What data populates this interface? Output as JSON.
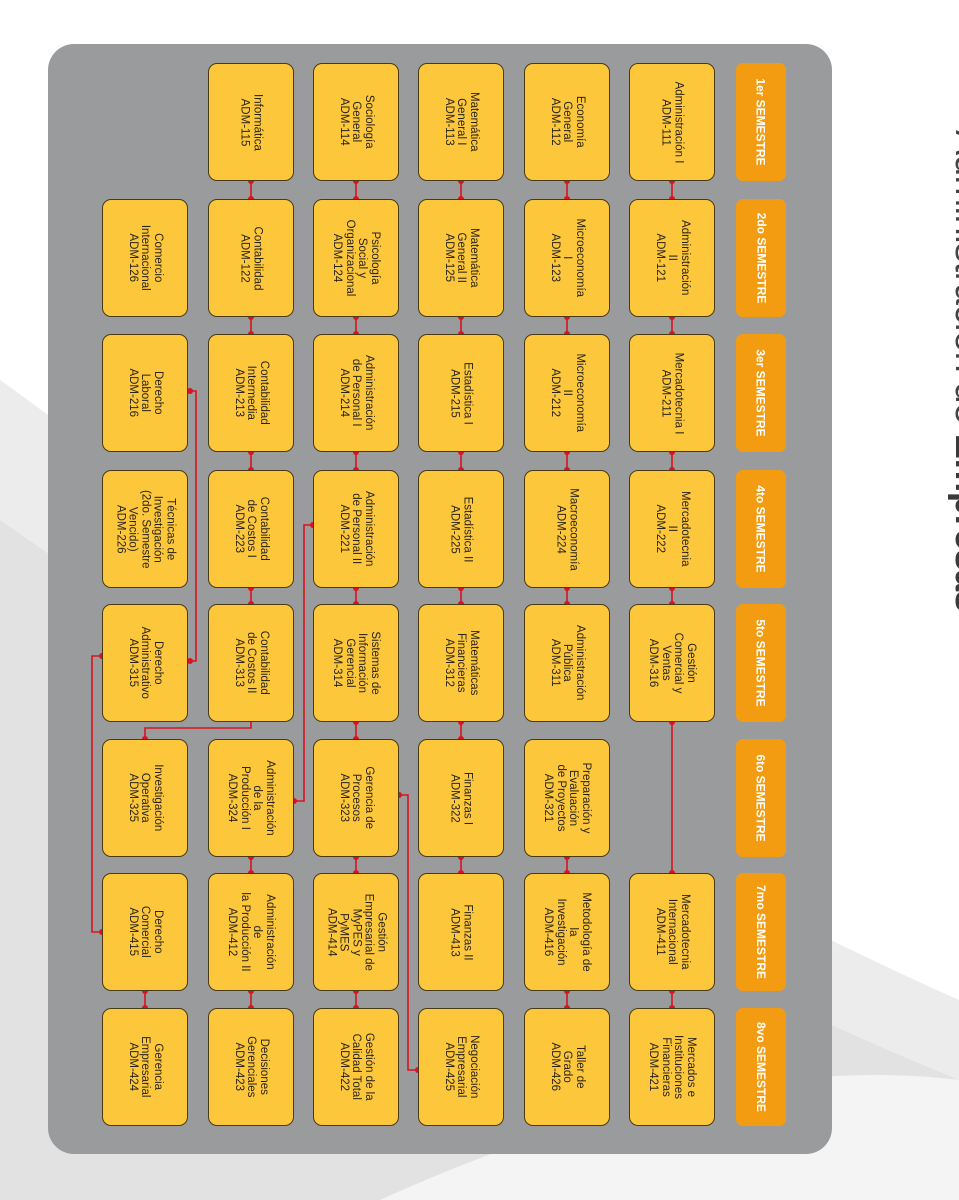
{
  "title": {
    "part1": "Administración de ",
    "part2": "Empresas"
  },
  "colors": {
    "panel": "#9a9b9d",
    "header": "#f39c12",
    "course": "#fcc73a",
    "connector": "#d7141f"
  },
  "semesters": [
    {
      "label": "1er SEMESTRE"
    },
    {
      "label": "2do SEMESTRE"
    },
    {
      "label": "3er SEMESTRE"
    },
    {
      "label": "4to SEMESTRE"
    },
    {
      "label": "5to SEMESTRE"
    },
    {
      "label": "6to SEMESTRE"
    },
    {
      "label": "7mo SEMESTRE"
    },
    {
      "label": "8vo SEMESTRE"
    }
  ],
  "courses": [
    {
      "sem": 0,
      "track": 0,
      "name": "Administración I",
      "code": "ADM-111"
    },
    {
      "sem": 0,
      "track": 1,
      "name": "Economía\nGeneral",
      "code": "ADM-112"
    },
    {
      "sem": 0,
      "track": 2,
      "name": "Matemática\nGeneral I",
      "code": "ADM-113"
    },
    {
      "sem": 0,
      "track": 3,
      "name": "Sociología\nGeneral",
      "code": "ADM-114"
    },
    {
      "sem": 0,
      "track": 4,
      "name": "Informática",
      "code": "ADM-115"
    },
    {
      "sem": 1,
      "track": 0,
      "name": "Administración II",
      "code": "ADM-121"
    },
    {
      "sem": 1,
      "track": 1,
      "name": "Microeconomía I",
      "code": "ADM-123"
    },
    {
      "sem": 1,
      "track": 2,
      "name": "Matemática\nGeneral II",
      "code": "ADM-125"
    },
    {
      "sem": 1,
      "track": 3,
      "name": "Psicología Social y\nOrganizacional",
      "code": "ADM-124"
    },
    {
      "sem": 1,
      "track": 4,
      "name": "Contabilidad",
      "code": "ADM-122"
    },
    {
      "sem": 1,
      "track": 5,
      "name": "Comercio\nInternacional",
      "code": "ADM-126"
    },
    {
      "sem": 2,
      "track": 0,
      "name": "Mercadotecnia I",
      "code": "ADM-211"
    },
    {
      "sem": 2,
      "track": 1,
      "name": "Microeconomía II",
      "code": "ADM-212"
    },
    {
      "sem": 2,
      "track": 2,
      "name": "Estadística I",
      "code": "ADM-215"
    },
    {
      "sem": 2,
      "track": 3,
      "name": "Administración\nde Personal I",
      "code": "ADM-214"
    },
    {
      "sem": 2,
      "track": 4,
      "name": "Contabilidad\nIntermedia",
      "code": "ADM-213"
    },
    {
      "sem": 2,
      "track": 5,
      "name": "Derecho\nLaboral",
      "code": "ADM-216"
    },
    {
      "sem": 3,
      "track": 0,
      "name": "Mercadotecnia II",
      "code": "ADM-222"
    },
    {
      "sem": 3,
      "track": 1,
      "name": "Macroeconomía",
      "code": "ADM-224"
    },
    {
      "sem": 3,
      "track": 2,
      "name": "Estadística II",
      "code": "ADM-225"
    },
    {
      "sem": 3,
      "track": 3,
      "name": "Administración\nde Personal II",
      "code": "ADM-221"
    },
    {
      "sem": 3,
      "track": 4,
      "name": "Contabilidad\nde Costos I",
      "code": "ADM-223"
    },
    {
      "sem": 3,
      "track": 5,
      "name": "Técnicas de Investigación\n(2do. Semestre Vencido)",
      "code": "ADM-226"
    },
    {
      "sem": 4,
      "track": 0,
      "name": "Gestión Comercial y\nVentas",
      "code": "ADM-316"
    },
    {
      "sem": 4,
      "track": 1,
      "name": "Administración\nPública",
      "code": "ADM-311"
    },
    {
      "sem": 4,
      "track": 2,
      "name": "Matemáticas\nFinancieras",
      "code": "ADM-312"
    },
    {
      "sem": 4,
      "track": 3,
      "name": "Sistemas de\nInformación Gerencial",
      "code": "ADM-314"
    },
    {
      "sem": 4,
      "track": 4,
      "name": "Contabilidad\nde Costos II",
      "code": "ADM-313"
    },
    {
      "sem": 4,
      "track": 5,
      "name": "Derecho\nAdministrativo",
      "code": "ADM-315"
    },
    {
      "sem": 5,
      "track": 1,
      "name": "Preparación y Evaluación\nde Proyectos",
      "code": "ADM-321"
    },
    {
      "sem": 5,
      "track": 2,
      "name": "Finanzas I",
      "code": "ADM-322"
    },
    {
      "sem": 5,
      "track": 3,
      "name": "Gerencia de Procesos",
      "code": "ADM-323"
    },
    {
      "sem": 5,
      "track": 4,
      "name": "Administración de la\nProducción I",
      "code": "ADM-324"
    },
    {
      "sem": 5,
      "track": 5,
      "name": "Investigación Operativa",
      "code": "ADM-325"
    },
    {
      "sem": 6,
      "track": 0,
      "name": "Mercadotecnia\nInternacional",
      "code": "ADM-411"
    },
    {
      "sem": 6,
      "track": 1,
      "name": "Metodología de la\nInvestigación",
      "code": "ADM-416"
    },
    {
      "sem": 6,
      "track": 2,
      "name": "Finanzas II",
      "code": "ADM-413"
    },
    {
      "sem": 6,
      "track": 3,
      "name": "Gestión Empresarial de\nMyPES y PyMES",
      "code": "ADM-414"
    },
    {
      "sem": 6,
      "track": 4,
      "name": "Administración de\nla Producción II",
      "code": "ADM-412"
    },
    {
      "sem": 6,
      "track": 5,
      "name": "Derecho\nComercial",
      "code": "ADM-415"
    },
    {
      "sem": 7,
      "track": 0,
      "name": "Mercados e\nInstituciones\nFinancieras",
      "code": "ADM-421"
    },
    {
      "sem": 7,
      "track": 1,
      "name": "Taller de\nGrado",
      "code": "ADM-426"
    },
    {
      "sem": 7,
      "track": 2,
      "name": "Negociación\nEmpresarial",
      "code": "ADM-425"
    },
    {
      "sem": 7,
      "track": 3,
      "name": "Gestión de la\nCalidad Total",
      "code": "ADM-422"
    },
    {
      "sem": 7,
      "track": 4,
      "name": "Decisiones\nGerenciales",
      "code": "ADM-423"
    },
    {
      "sem": 7,
      "track": 5,
      "name": "Gerencia\nEmpresarial",
      "code": "ADM-424"
    }
  ],
  "prerequisites": [
    [
      "ADM-111",
      "ADM-121"
    ],
    [
      "ADM-112",
      "ADM-123"
    ],
    [
      "ADM-113",
      "ADM-125"
    ],
    [
      "ADM-114",
      "ADM-124"
    ],
    [
      "ADM-115",
      "ADM-122"
    ],
    [
      "ADM-121",
      "ADM-211"
    ],
    [
      "ADM-123",
      "ADM-212"
    ],
    [
      "ADM-125",
      "ADM-215"
    ],
    [
      "ADM-124",
      "ADM-214"
    ],
    [
      "ADM-122",
      "ADM-213"
    ],
    [
      "ADM-211",
      "ADM-222"
    ],
    [
      "ADM-212",
      "ADM-224"
    ],
    [
      "ADM-215",
      "ADM-225"
    ],
    [
      "ADM-214",
      "ADM-221"
    ],
    [
      "ADM-213",
      "ADM-223"
    ],
    [
      "ADM-222",
      "ADM-316"
    ],
    [
      "ADM-224",
      "ADM-311"
    ],
    [
      "ADM-225",
      "ADM-312"
    ],
    [
      "ADM-221",
      "ADM-314"
    ],
    [
      "ADM-223",
      "ADM-313"
    ],
    [
      "ADM-312",
      "ADM-322"
    ],
    [
      "ADM-314",
      "ADM-323"
    ],
    [
      "ADM-322",
      "ADM-413"
    ],
    [
      "ADM-323",
      "ADM-414"
    ],
    [
      "ADM-324",
      "ADM-412"
    ],
    [
      "ADM-321",
      "ADM-416"
    ],
    [
      "ADM-316",
      "ADM-411"
    ],
    [
      "ADM-411",
      "ADM-421"
    ],
    [
      "ADM-416",
      "ADM-426"
    ],
    [
      "ADM-414",
      "ADM-422"
    ],
    [
      "ADM-412",
      "ADM-423"
    ],
    [
      "ADM-415",
      "ADM-424"
    ],
    [
      "ADM-216",
      "ADM-315"
    ],
    [
      "ADM-313",
      "ADM-325"
    ],
    [
      "ADM-221",
      "ADM-324"
    ],
    [
      "ADM-315",
      "ADM-415"
    ],
    [
      "ADM-323",
      "ADM-425"
    ]
  ]
}
